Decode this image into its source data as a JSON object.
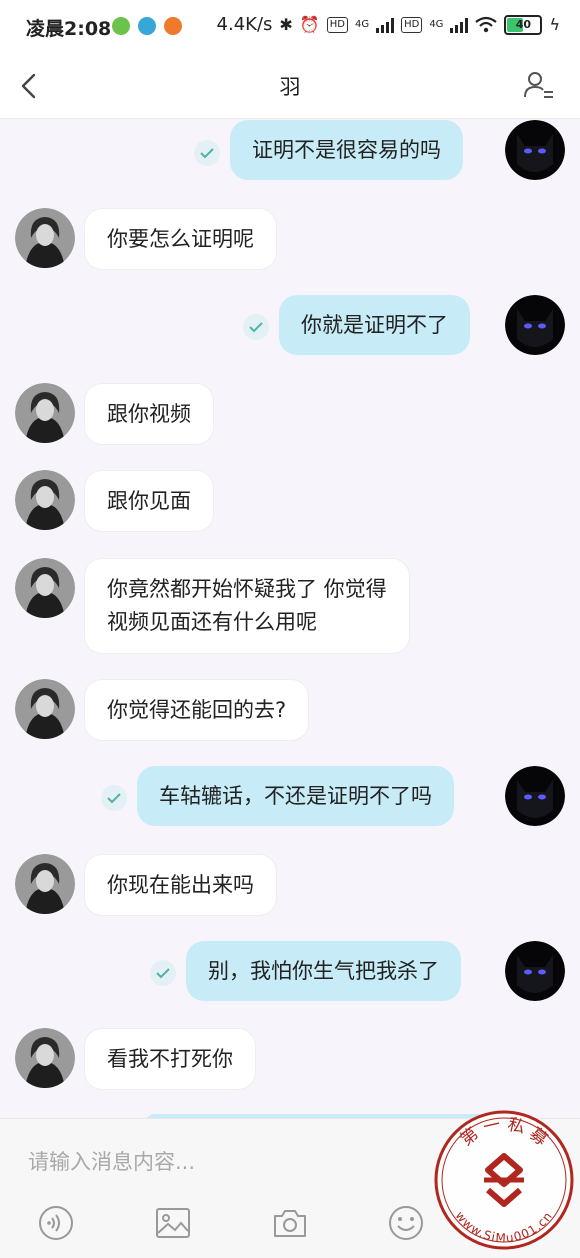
{
  "status": {
    "time": "凌晨2:08",
    "speed": "4.4K/s",
    "hd1": "HD",
    "net1": "4G",
    "hd2": "HD",
    "net2": "4G",
    "battery": "40",
    "app_icons": [
      "wechat-icon",
      "browser-icon",
      "app-icon"
    ],
    "app_colors": [
      "#6cc24a",
      "#37a7d8",
      "#f07a2b"
    ]
  },
  "header": {
    "title": "羽",
    "back_icon": "chevron-left-icon",
    "profile_icon": "user-list-icon"
  },
  "messages": [
    {
      "dir": "out",
      "text": "证明不是很容易的吗"
    },
    {
      "dir": "in",
      "text": "你要怎么证明呢"
    },
    {
      "dir": "out",
      "text": "你就是证明不了"
    },
    {
      "dir": "in",
      "text": "跟你视频"
    },
    {
      "dir": "in",
      "text": "跟你见面"
    },
    {
      "dir": "in",
      "line1": "你竟然都开始怀疑我了  你觉得",
      "line2": "视频见面还有什么用呢"
    },
    {
      "dir": "in",
      "text": "你觉得还能回的去?"
    },
    {
      "dir": "out",
      "text": "车轱辘话，不还是证明不了吗"
    },
    {
      "dir": "in",
      "text": "你现在能出来吗"
    },
    {
      "dir": "out",
      "text": "别，我怕你生气把我杀了"
    },
    {
      "dir": "in",
      "text": "看我不打死你"
    }
  ],
  "composer": {
    "placeholder": "请输入消息内容...",
    "tools": [
      "voice-icon",
      "image-icon",
      "camera-icon",
      "emoji-icon"
    ]
  },
  "watermark": {
    "top_text": "第 一 私 募",
    "bottom_text": "www.SiMu001.cn"
  },
  "colors": {
    "bubble_out": "#c8ecf7",
    "bubble_in": "#ffffff",
    "background": "#f8f4fb",
    "stamp": "#b0271f"
  }
}
